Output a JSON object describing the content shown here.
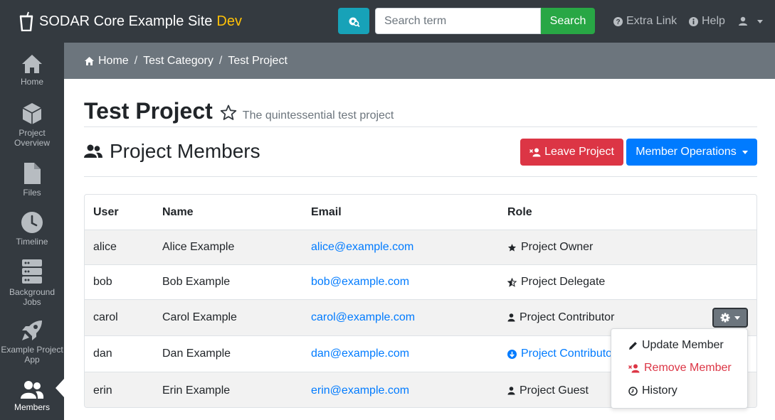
{
  "app": {
    "title": "SODAR Core Example Site",
    "env_badge": "Dev"
  },
  "navbar": {
    "search_placeholder": "Search term",
    "search_button": "Search",
    "links": [
      {
        "label": "Extra Link",
        "icon": "info-circle-icon"
      },
      {
        "label": "Help",
        "icon": "info-icon"
      }
    ],
    "user_icon": "user-icon"
  },
  "sidebar": {
    "items": [
      {
        "label": "Home",
        "icon": "home-icon"
      },
      {
        "label": "Project Overview",
        "icon": "cube-icon"
      },
      {
        "label": "Files",
        "icon": "file-icon"
      },
      {
        "label": "Timeline",
        "icon": "clock-icon"
      },
      {
        "label": "Background Jobs",
        "icon": "server-icon"
      },
      {
        "label": "Example Project App",
        "icon": "rocket-icon"
      },
      {
        "label": "Members",
        "icon": "users-icon",
        "active": true
      }
    ]
  },
  "breadcrumb": [
    "Home",
    "Test Category",
    "Test Project"
  ],
  "project": {
    "title": "Test Project",
    "description": "The quintessential test project"
  },
  "members_section": {
    "title": "Project Members",
    "leave_button": "Leave Project",
    "ops_button": "Member Operations"
  },
  "table": {
    "headers": [
      "User",
      "Name",
      "Email",
      "Role"
    ],
    "rows": [
      {
        "user": "alice",
        "name": "Alice Example",
        "email": "alice@example.com",
        "role": "Project Owner",
        "role_icon": "star-icon"
      },
      {
        "user": "bob",
        "name": "Bob Example",
        "email": "bob@example.com",
        "role": "Project Delegate",
        "role_icon": "star-half-icon"
      },
      {
        "user": "carol",
        "name": "Carol Example",
        "email": "carol@example.com",
        "role": "Project Contributor",
        "role_icon": "user-icon"
      },
      {
        "user": "dan",
        "name": "Dan Example",
        "email": "dan@example.com",
        "role": "Project Contributor",
        "role_icon": "arrow-down-circle-icon"
      },
      {
        "user": "erin",
        "name": "Erin Example",
        "email": "erin@example.com",
        "role": "Project Guest",
        "role_icon": "user-icon"
      }
    ]
  },
  "row_dropdown": {
    "items": [
      {
        "label": "Update Member",
        "icon": "pencil-icon"
      },
      {
        "label": "Remove Member",
        "icon": "user-remove-icon"
      },
      {
        "label": "History",
        "icon": "history-icon"
      }
    ]
  },
  "colors": {
    "navbar": "#343a40",
    "breadcrumb": "#6c757d",
    "danger": "#dc3545",
    "primary": "#007bff",
    "success": "#28a745",
    "info": "#17a2b8",
    "warning": "#ffc107"
  }
}
